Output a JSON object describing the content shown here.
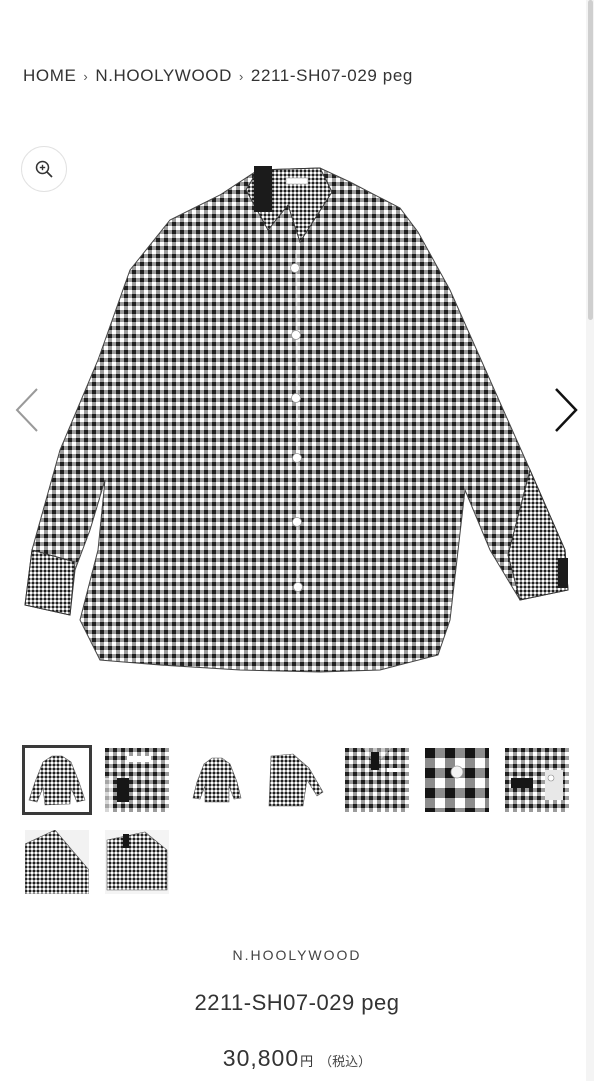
{
  "breadcrumb": {
    "home": "HOME",
    "separator": "›",
    "brand": "N.HOOLYWOOD",
    "current": "2211-SH07-029 peg"
  },
  "gallery": {
    "zoom_icon": "zoom-in-icon",
    "prev_icon": "chevron-left-icon",
    "next_icon": "chevron-right-icon",
    "thumbnail_count": 9,
    "active_thumbnail": 1
  },
  "product": {
    "brand": "N.HOOLYWOOD",
    "name": "2211-SH07-029 peg",
    "price": "30,800",
    "currency": "円",
    "tax_note": "（税込）"
  },
  "colors": {
    "text": "#333333",
    "gingham_dark": "#2b2b2b",
    "active_border": "#3a3a3a"
  }
}
